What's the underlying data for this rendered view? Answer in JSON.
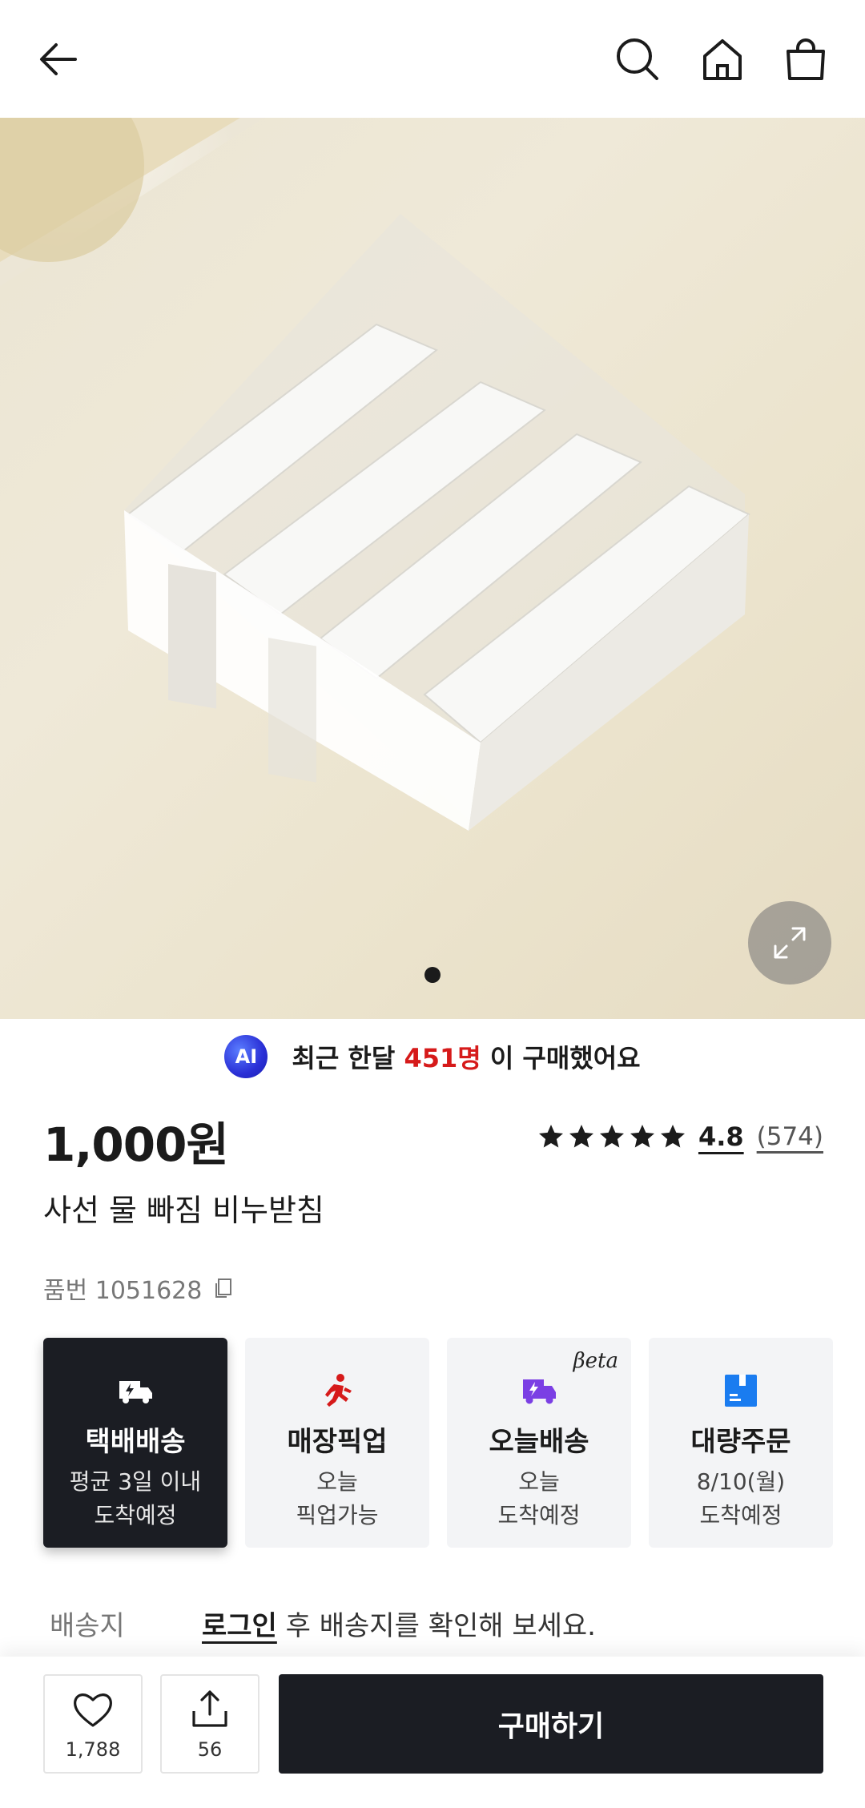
{
  "header": {
    "back_icon": "arrow-left-icon",
    "search_icon": "search-icon",
    "home_icon": "home-icon",
    "cart_icon": "shopping-bag-icon"
  },
  "gallery": {
    "page_count": 1,
    "current_page": 1,
    "expand_icon": "expand-icon"
  },
  "ai_banner": {
    "badge": "AI",
    "prefix": "최근 한달 ",
    "highlight": "451명",
    "suffix": " 이 구매했어요",
    "highlight_color": "#d61a1a"
  },
  "product": {
    "price": "1,000원",
    "title": "사선 물 빠짐 비누받침",
    "sku_label": "품번 1051628",
    "rating_score": "4.8",
    "rating_count": "(574)",
    "stars": 4.8
  },
  "delivery_options": [
    {
      "title": "택배배송",
      "line1": "평균 3일 이내",
      "line2": "도착예정",
      "icon": "delivery-truck-icon",
      "active": true
    },
    {
      "title": "매장픽업",
      "line1": "오늘",
      "line2": "픽업가능",
      "icon": "running-person-icon",
      "active": false
    },
    {
      "title": "오늘배송",
      "line1": "오늘",
      "line2": "도착예정",
      "icon": "fast-delivery-icon",
      "badge": "βeta",
      "active": false
    },
    {
      "title": "대량주문",
      "line1": "8/10(월)",
      "line2": "도착예정",
      "icon": "box-icon",
      "active": false
    }
  ],
  "shipping": {
    "label": "배송지",
    "login_link": "로그인",
    "message": " 후 배송지를 확인해 보세요."
  },
  "bottom_bar": {
    "like_count": "1,788",
    "share_count": "56",
    "buy_label": "구매하기"
  },
  "colors": {
    "dark": "#1b1d23",
    "accent_red": "#d61a1a",
    "accent_purple": "#7b3fe4",
    "accent_blue": "#1a7cf0"
  }
}
